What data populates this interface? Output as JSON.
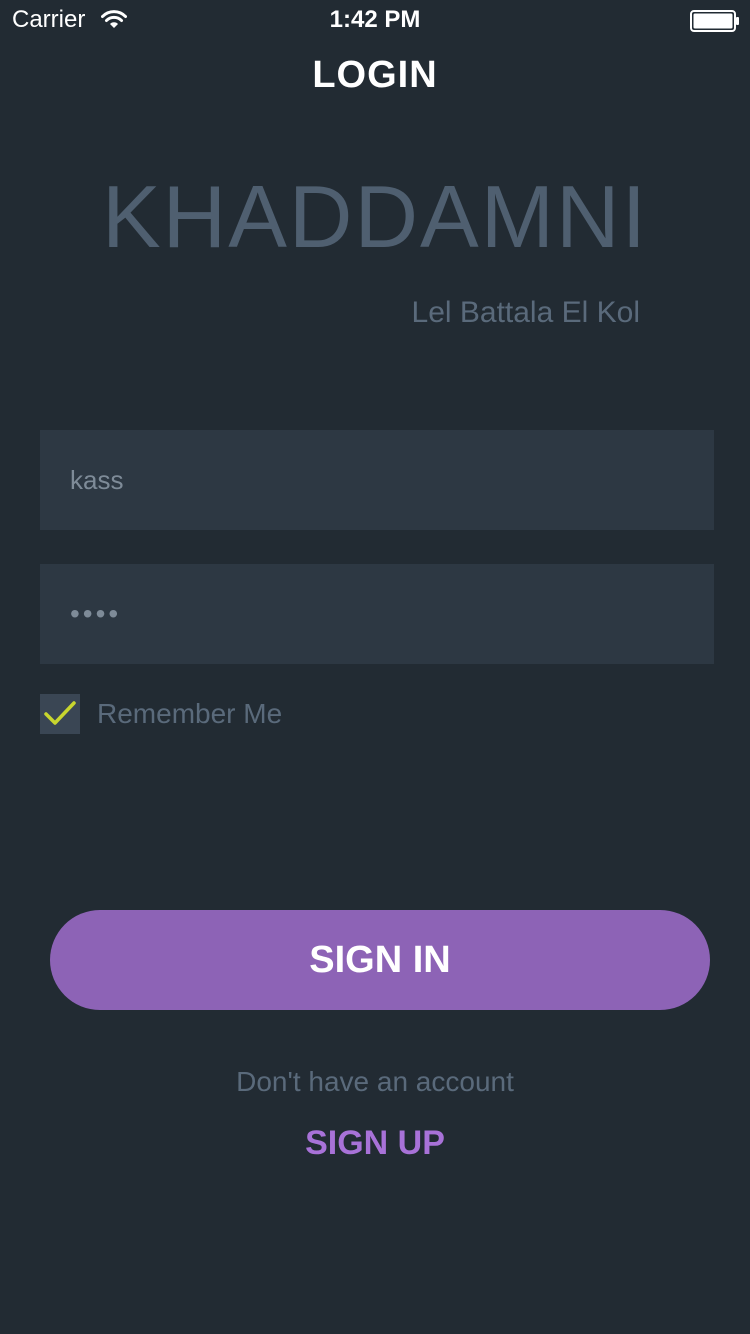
{
  "status_bar": {
    "carrier": "Carrier",
    "time": "1:42 PM"
  },
  "header": {
    "title": "LOGIN"
  },
  "brand": {
    "name": "KHADDAMNI",
    "tagline": "Lel Battala El Kol"
  },
  "form": {
    "username_value": "kass",
    "password_value": "••••",
    "remember_label": "Remember Me",
    "remember_checked": true
  },
  "actions": {
    "signin_label": "SIGN IN",
    "no_account_text": "Don't have an account",
    "signup_label": "SIGN UP"
  },
  "colors": {
    "background": "#222b33",
    "field": "#2d3843",
    "accent": "#8d63b6",
    "link": "#a872d8",
    "check": "#c8d62e"
  },
  "icons": {
    "wifi": "wifi-icon",
    "battery": "battery-icon",
    "check": "checkmark-icon"
  }
}
